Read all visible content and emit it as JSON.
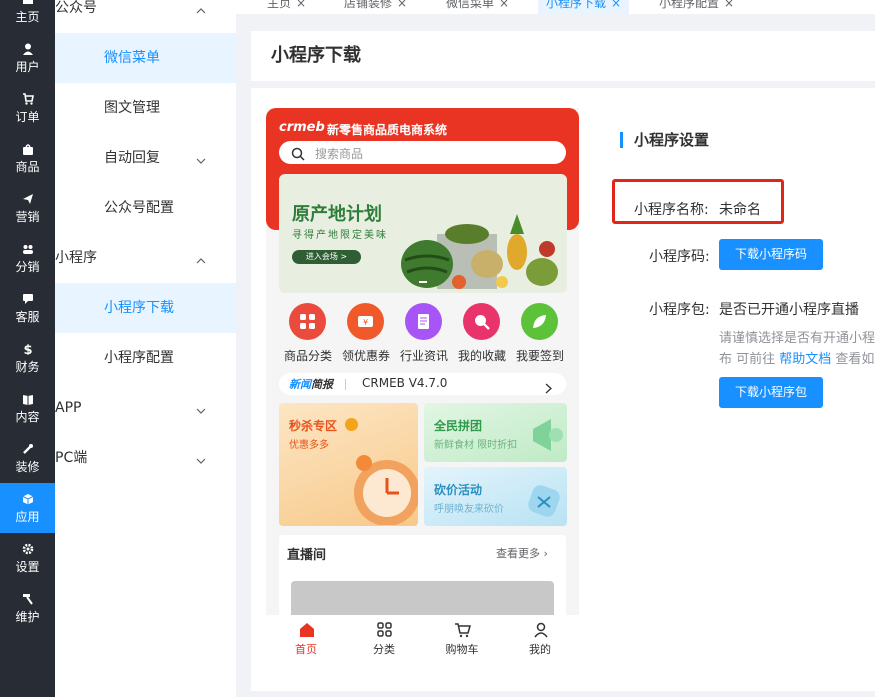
{
  "rail": {
    "items": [
      {
        "label": "主页",
        "icon": "home-icon"
      },
      {
        "label": "用户",
        "icon": "user-icon"
      },
      {
        "label": "订单",
        "icon": "cart-icon"
      },
      {
        "label": "商品",
        "icon": "bag-icon"
      },
      {
        "label": "营销",
        "icon": "send-icon"
      },
      {
        "label": "分销",
        "icon": "group-icon"
      },
      {
        "label": "客服",
        "icon": "chat-icon"
      },
      {
        "label": "财务",
        "icon": "dollar-icon"
      },
      {
        "label": "内容",
        "icon": "book-icon"
      },
      {
        "label": "装修",
        "icon": "tools-icon"
      },
      {
        "label": "应用",
        "icon": "cube-icon"
      },
      {
        "label": "设置",
        "icon": "gear-icon"
      },
      {
        "label": "维护",
        "icon": "hammer-icon"
      }
    ],
    "active_index": 10
  },
  "menu": {
    "items": [
      {
        "label": "公众号",
        "kind": "group",
        "chevron": "up"
      },
      {
        "label": "微信菜单",
        "kind": "sub",
        "active": true
      },
      {
        "label": "图文管理",
        "kind": "sub"
      },
      {
        "label": "自动回复",
        "kind": "sub",
        "chevron": "down"
      },
      {
        "label": "公众号配置",
        "kind": "sub"
      },
      {
        "label": "小程序",
        "kind": "group",
        "chevron": "up"
      },
      {
        "label": "小程序下载",
        "kind": "sub",
        "active": true
      },
      {
        "label": "小程序配置",
        "kind": "sub"
      },
      {
        "label": "APP",
        "kind": "group",
        "chevron": "down"
      },
      {
        "label": "PC端",
        "kind": "group",
        "chevron": "down"
      }
    ]
  },
  "tabs": [
    {
      "label": "主页",
      "close": "×"
    },
    {
      "label": "店铺装修",
      "close": "×"
    },
    {
      "label": "微信菜单",
      "close": "×"
    },
    {
      "label": "小程序下载",
      "close": "×",
      "active": true
    },
    {
      "label": "小程序配置",
      "close": "×"
    }
  ],
  "page": {
    "title": "小程序下载"
  },
  "phone": {
    "brand": "crmeb",
    "store_title": "新零售商品质电商系统",
    "search_placeholder": "搜索商品",
    "banner_title": "原产地计划",
    "banner_subtitle": "寻得产地限定美味",
    "banner_button": "进入会场 >",
    "quick_items": [
      {
        "label": "商品分类",
        "color": "#ea4b3c"
      },
      {
        "label": "领优惠券",
        "color": "#f05a2a"
      },
      {
        "label": "行业资讯",
        "color": "#a855f7"
      },
      {
        "label": "我的收藏",
        "color": "#e8336b"
      },
      {
        "label": "我要签到",
        "color": "#5cc23a"
      }
    ],
    "news_tag_a": "新闻",
    "news_tag_b": "简报",
    "news_text": "CRMEB V4.7.0",
    "promos": [
      {
        "title": "秒杀专区",
        "sub": "优惠多多"
      },
      {
        "title": "全民拼团",
        "sub": "新鲜食材 限时折扣"
      },
      {
        "title": "砍价活动",
        "sub": "呼朋唤友来砍价"
      }
    ],
    "live_title": "直播间",
    "live_more": "查看更多 ›",
    "tabbar": [
      {
        "label": "首页",
        "icon": "home-icon",
        "active": true
      },
      {
        "label": "分类",
        "icon": "grid-icon"
      },
      {
        "label": "购物车",
        "icon": "cart-icon"
      },
      {
        "label": "我的",
        "icon": "profile-icon"
      }
    ]
  },
  "settings": {
    "section_title": "小程序设置",
    "name_label": "小程序名称:",
    "name_value": "未命名",
    "code_label": "小程序码:",
    "code_button": "下载小程序码",
    "pkg_label": "小程序包:",
    "pkg_question": "是否已开通小程序直播",
    "pkg_hint_line1": "请谨慎选择是否有开通小程序直播功能,否则将导致小程序无法发",
    "pkg_hint_line2_a": "布 可前往 ",
    "pkg_hint_link": "帮助文档",
    "pkg_hint_line2_b": " 查看如何开通直播功能",
    "pkg_button": "下载小程序包",
    "highlight_color": "#e0261b",
    "accent": "#1890ff"
  }
}
